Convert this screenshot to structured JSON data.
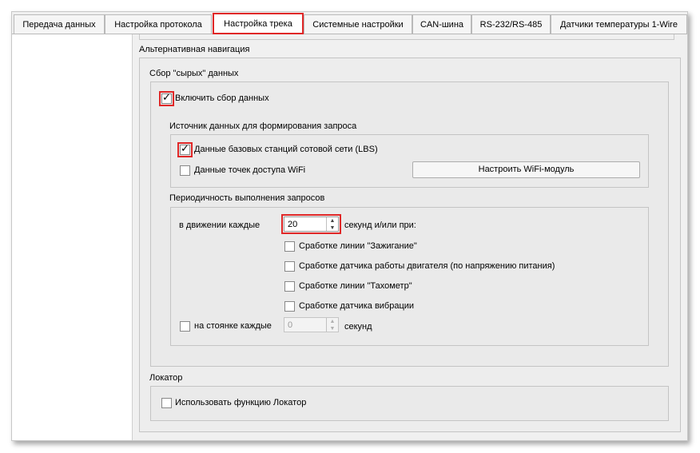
{
  "tabs": [
    {
      "label": "Передача данных"
    },
    {
      "label": "Настройка протокола"
    },
    {
      "label": "Настройка трека",
      "active": true
    },
    {
      "label": "Системные настройки"
    },
    {
      "label": "CAN-шина"
    },
    {
      "label": "RS-232/RS-485"
    },
    {
      "label": "Датчики температуры 1-Wire"
    }
  ],
  "alt_nav": {
    "title": "Альтернативная навигация",
    "raw": {
      "title": "Сбор \"сырых\" данных",
      "enable_label": "Включить сбор данных",
      "enable_checked": true,
      "source": {
        "title": "Источник данных для формирования запроса",
        "lbs_label": "Данные базовых станций сотовой сети (LBS)",
        "lbs_checked": true,
        "wifi_label": "Данные точек доступа WiFi",
        "wifi_checked": false,
        "wifi_button": "Настроить WiFi-модуль"
      },
      "period": {
        "title": "Периодичность выполнения запросов",
        "moving_label": "в движении каждые",
        "moving_value": "20",
        "moving_suffix": "секунд и/или при:",
        "triggers": [
          {
            "label": "Сработке линии \"Зажигание\"",
            "checked": false
          },
          {
            "label": "Сработке датчика работы двигателя (по напряжению питания)",
            "checked": false
          },
          {
            "label": "Сработке линии \"Тахометр\"",
            "checked": false
          },
          {
            "label": "Сработке датчика вибрации",
            "checked": false
          }
        ],
        "parked_label": "на стоянке каждые",
        "parked_checked": false,
        "parked_value": "0",
        "parked_suffix": "секунд"
      }
    },
    "locator": {
      "title": "Локатор",
      "use_label": "Использовать функцию Локатор",
      "use_checked": false
    }
  }
}
